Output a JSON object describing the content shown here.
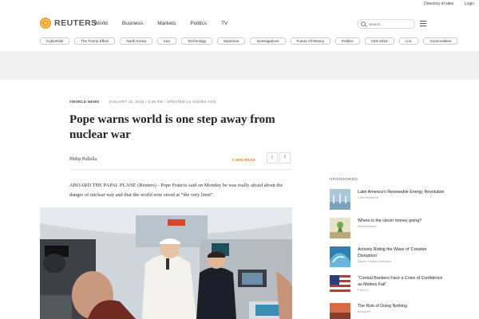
{
  "utility": {
    "directory": "Directory of sites",
    "login": "Login"
  },
  "brand": {
    "name": "REUTERS"
  },
  "nav": [
    "World",
    "Business",
    "Markets",
    "Politics",
    "TV"
  ],
  "search": {
    "placeholder": "Search..."
  },
  "tags": [
    "CyberRisk",
    "The Trump Effect",
    "North Korea",
    "Iran",
    "Technology",
    "Myanmar",
    "Investigations",
    "Future Of Money",
    "Politics",
    "CES 2018",
    "U.S.",
    "Commodities"
  ],
  "article": {
    "section": "#WORLD NEWS",
    "dateline": "JANUARY 15, 2018 / 5:38 PM / UPDATED 14 HOURS AGO",
    "headline": "Pope warns world is one step away from nuclear war",
    "author": "Philip Pullella",
    "read_time": "2 MIN READ",
    "share": {
      "twitter": "t",
      "facebook": "f"
    },
    "lede": "ABOARD THE PAPAL PLANE (Reuters) - Pope Francis said on Monday he was really afraid about the danger of nuclear war and that the world now stood at “the very limit”."
  },
  "sponsored": {
    "label": "SPONSORED",
    "items": [
      {
        "title": "Latin America's Renewable Energy Revolution",
        "source": "Latin Investors"
      },
      {
        "title": "Where is the clever money going?",
        "source": "MarketWatch"
      },
      {
        "title": "Actively Riding the Wave of 'Creative Disruption'",
        "source": "Allianz Global Investors"
      },
      {
        "title": "“Central Bankers Face a Crisis of Confidence as Models Fail”",
        "source": "PIMCO"
      },
      {
        "title": "The Risk of Doing Nothing",
        "source": "Blueprint"
      }
    ]
  }
}
